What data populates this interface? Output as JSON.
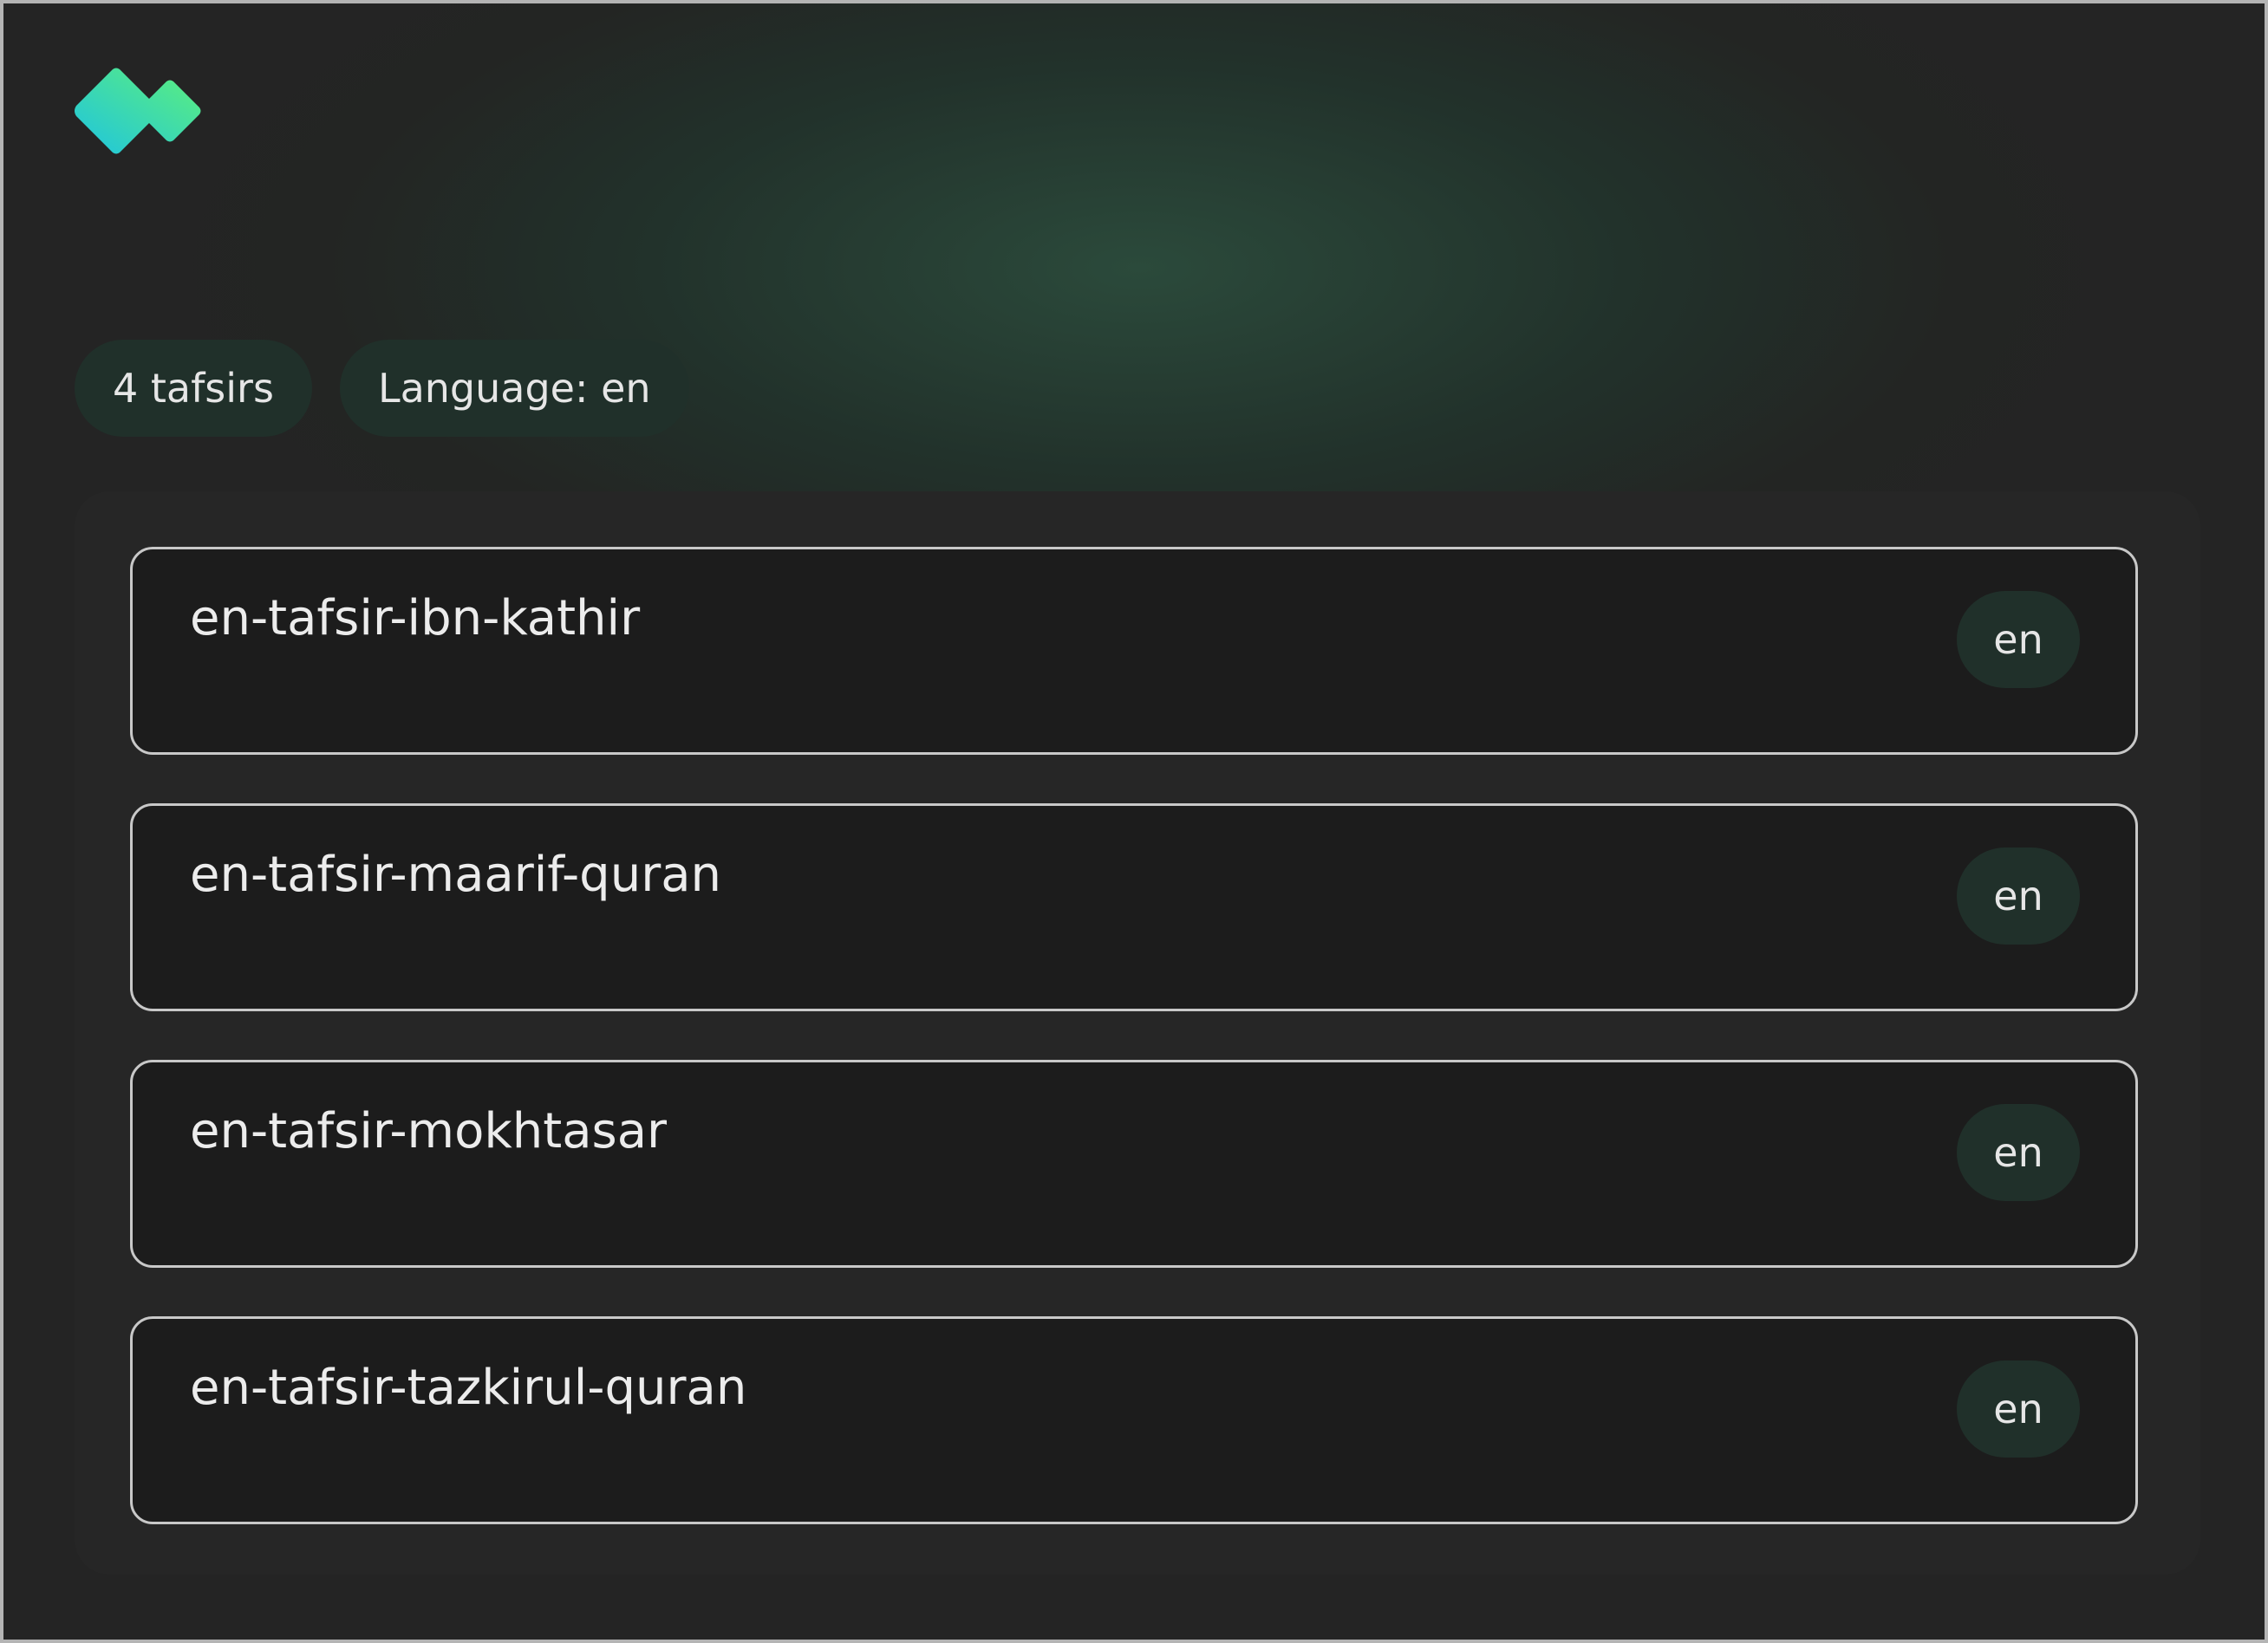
{
  "header": {
    "logo_icon": "brand-logo-icon",
    "logo_colors": {
      "start": "#1ec4e0",
      "end": "#5ef07a"
    }
  },
  "stats": {
    "count_label": "4 tafsirs",
    "language_label": "Language: en"
  },
  "tafsirs": [
    {
      "name": "en-tafsir-ibn-kathir",
      "lang": "en"
    },
    {
      "name": "en-tafsir-maarif-quran",
      "lang": "en"
    },
    {
      "name": "en-tafsir-mokhtasar",
      "lang": "en"
    },
    {
      "name": "en-tafsir-tazkirul-quran",
      "lang": "en"
    }
  ]
}
